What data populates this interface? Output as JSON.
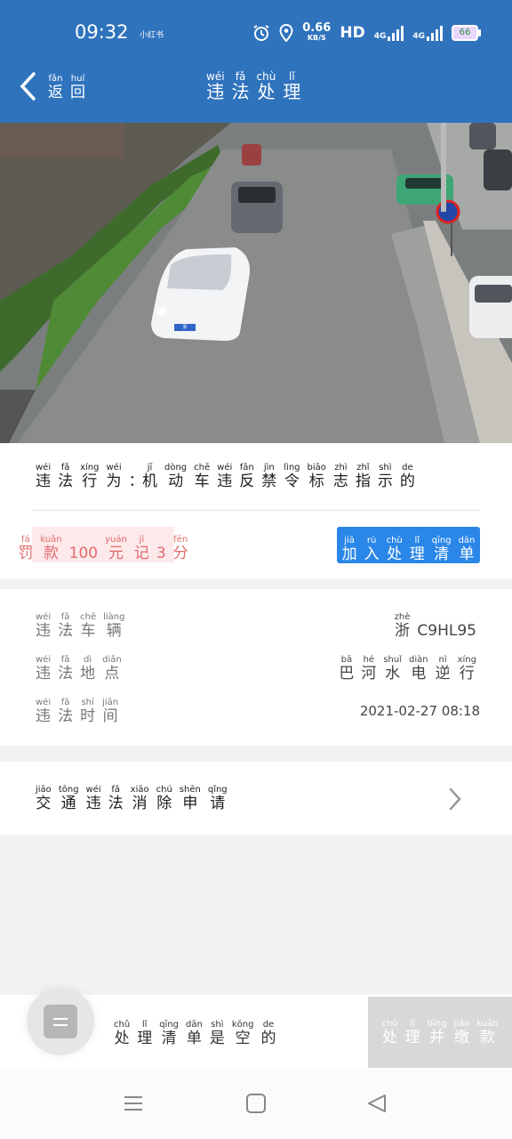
{
  "status": {
    "time": "09:32",
    "carrier": "小红书",
    "speed_value": "0.66",
    "speed_unit": "KB/S",
    "hd": "HD",
    "sig1": "4G",
    "sig2": "4G",
    "battery": "66"
  },
  "header": {
    "back": [
      {
        "p": "fǎn",
        "c": "返"
      },
      {
        "p": "huí",
        "c": "回"
      }
    ],
    "title": [
      {
        "p": "wéi",
        "c": "违"
      },
      {
        "p": "fǎ",
        "c": "法"
      },
      {
        "p": "chù",
        "c": "处"
      },
      {
        "p": "lǐ",
        "c": "理"
      }
    ]
  },
  "photo": {
    "plate_text": "浙C9HL95"
  },
  "violation": {
    "label": [
      {
        "p": "wéi",
        "c": "违"
      },
      {
        "p": "fǎ",
        "c": "法"
      },
      {
        "p": "xíng",
        "c": "行"
      },
      {
        "p": "wéi",
        "c": "为"
      },
      {
        "p": "",
        "c": "："
      }
    ],
    "text": [
      {
        "p": "jī",
        "c": "机"
      },
      {
        "p": "dòng",
        "c": "动"
      },
      {
        "p": "chē",
        "c": "车"
      },
      {
        "p": "wéi",
        "c": "违"
      },
      {
        "p": "fǎn",
        "c": "反"
      },
      {
        "p": "jìn",
        "c": "禁"
      },
      {
        "p": "lìng",
        "c": "令"
      },
      {
        "p": "biāo",
        "c": "标"
      },
      {
        "p": "zhì",
        "c": "志"
      },
      {
        "p": "zhǐ",
        "c": "指"
      },
      {
        "p": "shì",
        "c": "示"
      },
      {
        "p": "de",
        "c": "的"
      }
    ],
    "fine": [
      {
        "p": "fá",
        "c": "罚"
      },
      {
        "p": "kuǎn",
        "c": "款"
      },
      {
        "p": "",
        "c": "100"
      },
      {
        "p": "yuán",
        "c": "元"
      },
      {
        "p": "jì",
        "c": "记"
      },
      {
        "p": "",
        "c": "3"
      },
      {
        "p": "fēn",
        "c": "分"
      }
    ],
    "add_button": [
      {
        "p": "jiā",
        "c": "加"
      },
      {
        "p": "rù",
        "c": "入"
      },
      {
        "p": "chù",
        "c": "处"
      },
      {
        "p": "lǐ",
        "c": "理"
      },
      {
        "p": "qīng",
        "c": "清"
      },
      {
        "p": "dān",
        "c": "单"
      }
    ]
  },
  "details": {
    "vehicle_label": [
      {
        "p": "wéi",
        "c": "违"
      },
      {
        "p": "fǎ",
        "c": "法"
      },
      {
        "p": "chē",
        "c": "车"
      },
      {
        "p": "liàng",
        "c": "辆"
      }
    ],
    "vehicle_value": [
      {
        "p": "zhè",
        "c": "浙"
      },
      {
        "p": "",
        "c": "C9HL95"
      }
    ],
    "place_label": [
      {
        "p": "wéi",
        "c": "违"
      },
      {
        "p": "fǎ",
        "c": "法"
      },
      {
        "p": "dì",
        "c": "地"
      },
      {
        "p": "diǎn",
        "c": "点"
      }
    ],
    "place_value": [
      {
        "p": "bā",
        "c": "巴"
      },
      {
        "p": "hé",
        "c": "河"
      },
      {
        "p": "shuǐ",
        "c": "水"
      },
      {
        "p": "diàn",
        "c": "电"
      },
      {
        "p": "nì",
        "c": "逆"
      },
      {
        "p": "xíng",
        "c": "行"
      }
    ],
    "time_label": [
      {
        "p": "wéi",
        "c": "违"
      },
      {
        "p": "fǎ",
        "c": "法"
      },
      {
        "p": "shí",
        "c": "时"
      },
      {
        "p": "jiān",
        "c": "间"
      }
    ],
    "time_value": "2021-02-27 08:18"
  },
  "appeal": {
    "label": [
      {
        "p": "jiāo",
        "c": "交"
      },
      {
        "p": "tōng",
        "c": "通"
      },
      {
        "p": "wéi",
        "c": "违"
      },
      {
        "p": "fǎ",
        "c": "法"
      },
      {
        "p": "xiāo",
        "c": "消"
      },
      {
        "p": "chú",
        "c": "除"
      },
      {
        "p": "shēn",
        "c": "申"
      },
      {
        "p": "qǐng",
        "c": "请"
      }
    ]
  },
  "bottom": {
    "empty_text": [
      {
        "p": "chǔ",
        "c": "处"
      },
      {
        "p": "lǐ",
        "c": "理"
      },
      {
        "p": "qīng",
        "c": "清"
      },
      {
        "p": "dān",
        "c": "单"
      },
      {
        "p": "shì",
        "c": "是"
      },
      {
        "p": "kōng",
        "c": "空"
      },
      {
        "p": "de",
        "c": "的"
      }
    ],
    "pay_button": [
      {
        "p": "chǔ",
        "c": "处"
      },
      {
        "p": "lǐ",
        "c": "理"
      },
      {
        "p": "bìng",
        "c": "并"
      },
      {
        "p": "jiǎo",
        "c": "缴"
      },
      {
        "p": "kuǎn",
        "c": "款"
      }
    ]
  },
  "colors": {
    "header": "#2f73bd",
    "accent_button": "#2a87e8",
    "fine_text": "#e06c6c",
    "fine_bg": "#fde8ea"
  },
  "icons": [
    "back-chevron-icon",
    "alarm-icon",
    "location-icon",
    "chevron-right-icon",
    "list-icon",
    "nav-menu-icon",
    "nav-home-icon",
    "nav-back-icon"
  ]
}
